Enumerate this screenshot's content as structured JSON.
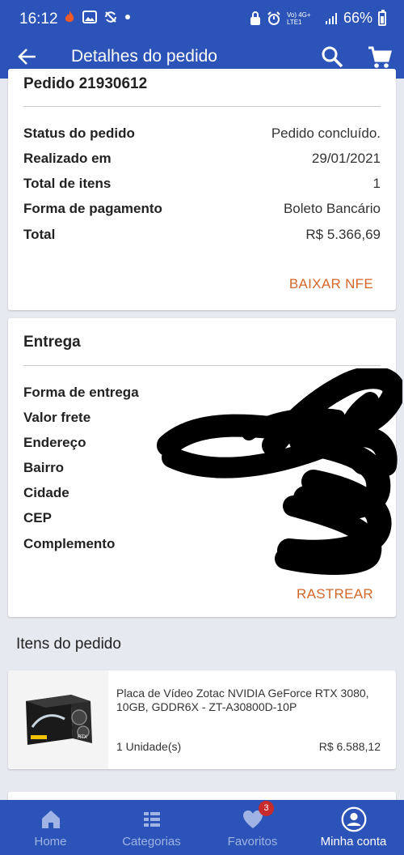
{
  "status_bar": {
    "time": "16:12",
    "left_icons": [
      "flame-icon",
      "image-icon",
      "sync-off-icon",
      "dot-icon"
    ],
    "right_icons": [
      "lock-icon",
      "alarm-icon",
      "volte-icon",
      "signal-icon",
      "battery-icon"
    ],
    "network_label": "Vo) 4G+ LTE1",
    "battery": "66%"
  },
  "app_bar": {
    "title": "Detalhes do pedido",
    "back_icon": "arrow-back-icon",
    "search_icon": "search-icon",
    "cart_icon": "cart-icon"
  },
  "order": {
    "title": "Pedido 21930612",
    "rows": [
      {
        "label": "Status do pedido",
        "value": "Pedido concluído."
      },
      {
        "label": "Realizado em",
        "value": "29/01/2021"
      },
      {
        "label": "Total de itens",
        "value": "1"
      },
      {
        "label": "Forma de pagamento",
        "value": "Boleto Bancário"
      },
      {
        "label": "Total",
        "value": "R$ 5.366,69"
      }
    ],
    "action": "BAIXAR NFE"
  },
  "delivery": {
    "title": "Entrega",
    "rows": [
      {
        "label": "Forma de entrega"
      },
      {
        "label": "Valor frete"
      },
      {
        "label": "Endereço"
      },
      {
        "label": "Bairro"
      },
      {
        "label": "Cidade"
      },
      {
        "label": "CEP"
      },
      {
        "label": "Complemento"
      }
    ],
    "action": "RASTREAR"
  },
  "items": {
    "heading": "Itens do pedido",
    "list": [
      {
        "name": "Placa de Vídeo Zotac NVIDIA GeForce RTX 3080, 10GB, GDDR6X - ZT-A30800D-10P",
        "quantity": "1 Unidade(s)",
        "price": "R$ 6.588,12"
      }
    ]
  },
  "bottom_nav": {
    "items": [
      {
        "label": "Home",
        "icon": "home-icon"
      },
      {
        "label": "Categorias",
        "icon": "categories-icon"
      },
      {
        "label": "Favoritos",
        "icon": "heart-icon",
        "badge": "3"
      },
      {
        "label": "Minha conta",
        "icon": "account-icon",
        "active": true
      }
    ]
  },
  "colors": {
    "primary": "#2c54b8",
    "accent": "#d3672a",
    "background": "#e7e9f0",
    "badge": "#c62a2a"
  }
}
